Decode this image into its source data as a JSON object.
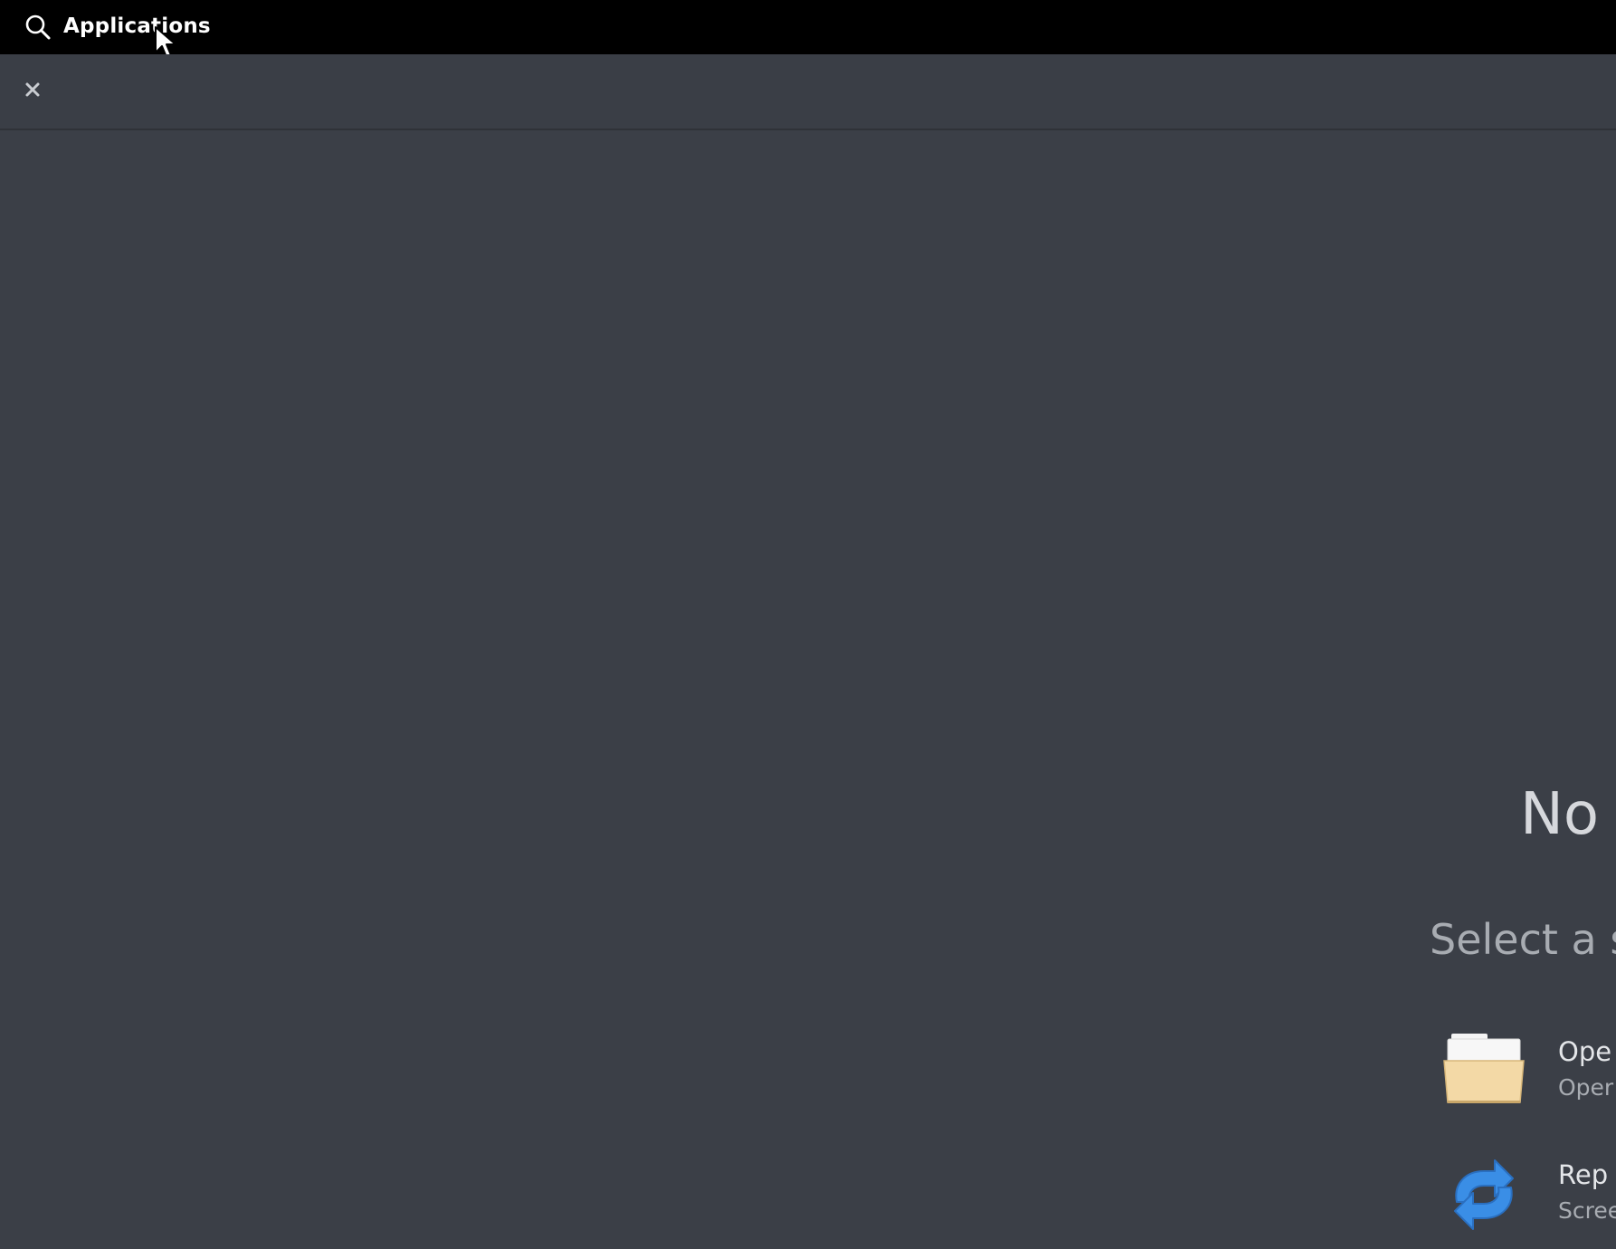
{
  "topbar": {
    "applications_label": "Applications",
    "icon": "search-icon"
  },
  "window": {
    "close_icon": "close-icon",
    "welcome": {
      "title": "No V",
      "subtitle": "Select a sc",
      "actions": [
        {
          "icon": "folder-icon",
          "title": "Ope",
          "description": "Oper"
        },
        {
          "icon": "replay-icon",
          "title": "Rep",
          "description": "Scree"
        }
      ]
    }
  },
  "colors": {
    "topbar_bg": "#000000",
    "window_bg": "#3b3f47",
    "headerbar_bg": "#3a3e46",
    "folder": "#f3d9a6",
    "replay": "#3a8ee6"
  }
}
